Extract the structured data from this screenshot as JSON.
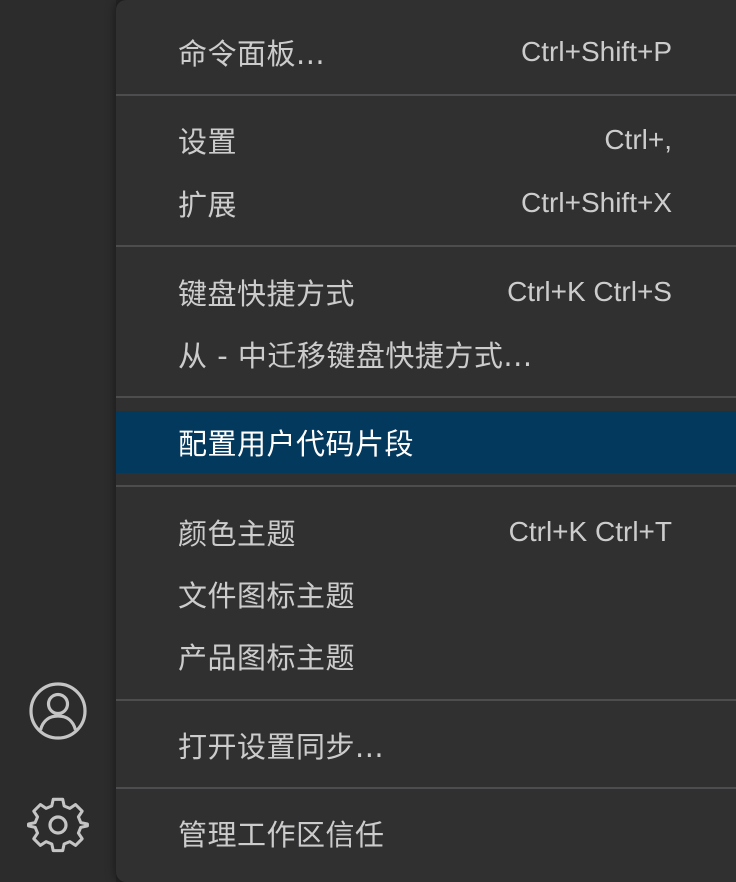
{
  "activity_bar": {
    "account_icon": "account-icon",
    "settings_icon": "gear-icon"
  },
  "menu": {
    "items": [
      {
        "label": "命令面板...",
        "shortcut": "Ctrl+Shift+P"
      },
      {
        "label": "设置",
        "shortcut": "Ctrl+,"
      },
      {
        "label": "扩展",
        "shortcut": "Ctrl+Shift+X"
      },
      {
        "label": "键盘快捷方式",
        "shortcut": "Ctrl+K Ctrl+S"
      },
      {
        "label": "从 - 中迁移键盘快捷方式...",
        "shortcut": ""
      },
      {
        "label": "配置用户代码片段",
        "shortcut": "",
        "active": true
      },
      {
        "label": "颜色主题",
        "shortcut": "Ctrl+K Ctrl+T"
      },
      {
        "label": "文件图标主题",
        "shortcut": ""
      },
      {
        "label": "产品图标主题",
        "shortcut": ""
      },
      {
        "label": "打开设置同步...",
        "shortcut": ""
      },
      {
        "label": "管理工作区信任",
        "shortcut": ""
      }
    ]
  },
  "colors": {
    "menu_background": "#303031",
    "active_item": "#04395e",
    "text": "#cccccc",
    "separator": "#4d4d4f"
  }
}
